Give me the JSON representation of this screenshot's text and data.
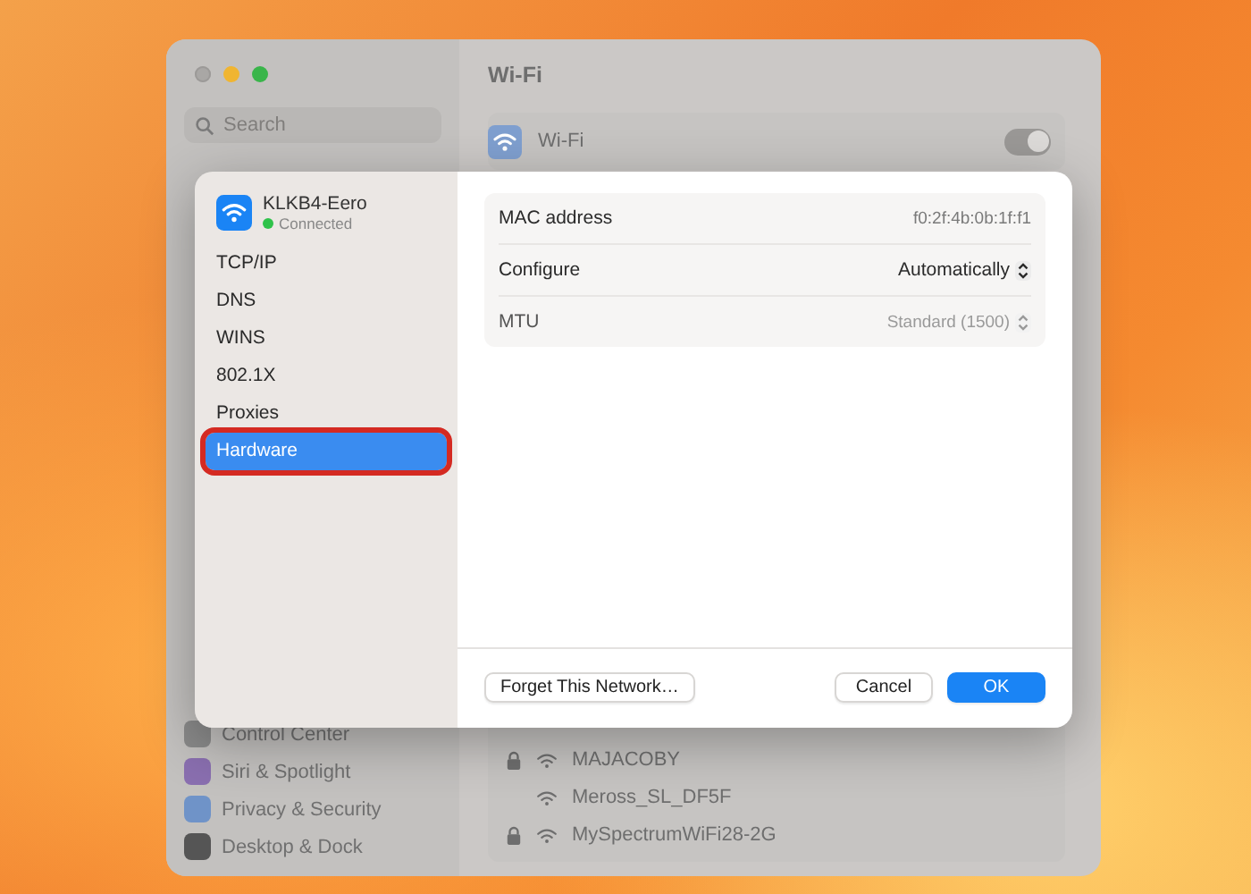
{
  "window": {
    "title": "Wi-Fi"
  },
  "sidebar": {
    "search": {
      "placeholder": "Search"
    },
    "items": [
      {
        "label": "Control Center",
        "color": "#8a8a8a"
      },
      {
        "label": "Siri & Spotlight",
        "color": "#8a6fb0"
      },
      {
        "label": "Privacy & Security",
        "color": "#6f93c8"
      },
      {
        "label": "Desktop & Dock",
        "color": "#555555"
      }
    ]
  },
  "wifi": {
    "label": "Wi-Fi",
    "on": true
  },
  "networks": [
    {
      "name": "MAJACOBY",
      "locked": true
    },
    {
      "name": "Meross_SL_DF5F",
      "locked": false
    },
    {
      "name": "MySpectrumWiFi28-2G",
      "locked": true
    }
  ],
  "dialog": {
    "network": {
      "name": "KLKB4-Eero",
      "status": "Connected",
      "connected": true
    },
    "nav": [
      {
        "label": "TCP/IP",
        "selected": false
      },
      {
        "label": "DNS",
        "selected": false
      },
      {
        "label": "WINS",
        "selected": false
      },
      {
        "label": "802.1X",
        "selected": false
      },
      {
        "label": "Proxies",
        "selected": false
      },
      {
        "label": "Hardware",
        "selected": true
      }
    ],
    "fields": [
      {
        "label": "MAC address",
        "value": "f0:2f:4b:0b:1f:f1",
        "kind": "text",
        "disabled": false
      },
      {
        "label": "Configure",
        "value": "Automatically",
        "kind": "popup",
        "disabled": false
      },
      {
        "label": "MTU",
        "value": "Standard (1500)",
        "kind": "popup",
        "disabled": true
      }
    ],
    "buttons": [
      {
        "label": "Forget This Network…",
        "kind": "secondary"
      },
      {
        "label": "Cancel",
        "kind": "normal"
      },
      {
        "label": "OK",
        "kind": "primary"
      }
    ]
  }
}
